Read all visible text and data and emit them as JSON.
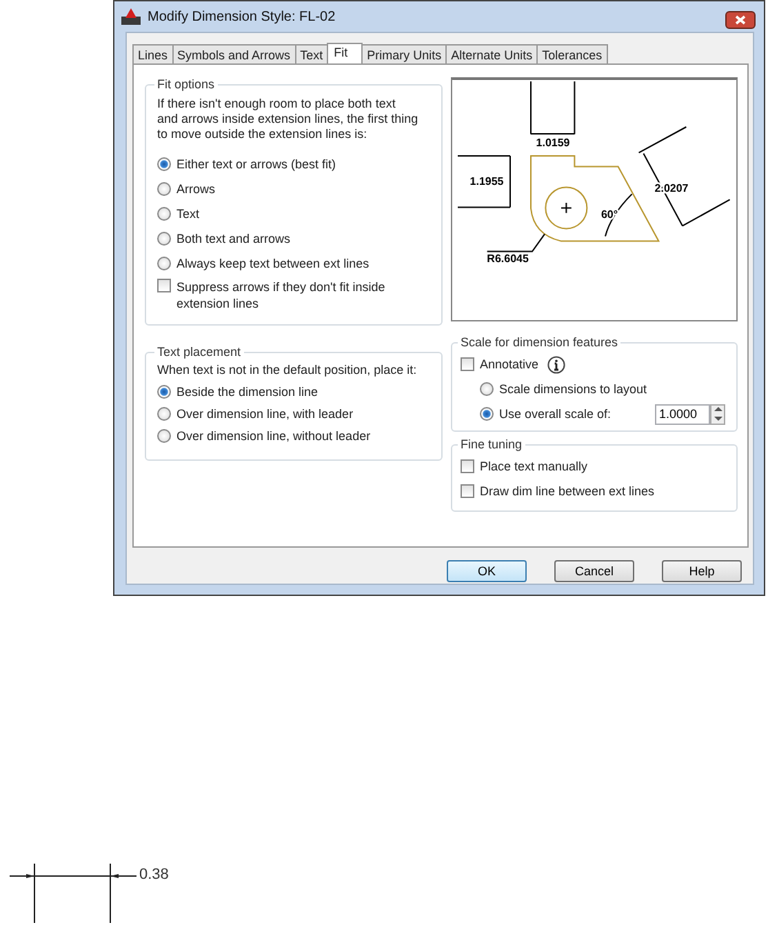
{
  "window": {
    "title": "Modify Dimension Style: FL-02"
  },
  "tabs": [
    {
      "label": "Lines",
      "selected": false
    },
    {
      "label": "Symbols and Arrows",
      "selected": false
    },
    {
      "label": "Text",
      "selected": false
    },
    {
      "label": "Fit",
      "selected": true
    },
    {
      "label": "Primary Units",
      "selected": false
    },
    {
      "label": "Alternate Units",
      "selected": false
    },
    {
      "label": "Tolerances",
      "selected": false
    }
  ],
  "fit_options": {
    "title": "Fit options",
    "description": "If there isn't enough room to place both text and arrows inside extension lines, the first thing to move outside the extension lines is:",
    "options": [
      {
        "label": "Either text or arrows (best fit)",
        "selected": true
      },
      {
        "label": "Arrows",
        "selected": false
      },
      {
        "label": "Text",
        "selected": false
      },
      {
        "label": "Both text and arrows",
        "selected": false
      },
      {
        "label": "Always keep text between ext lines",
        "selected": false
      }
    ],
    "suppress_arrows": {
      "label": "Suppress arrows if they don't fit inside extension lines",
      "checked": false
    }
  },
  "preview": {
    "labels": [
      "1.0159",
      "1.1955",
      "2.0207",
      "60°",
      "R6.6045"
    ]
  },
  "text_placement": {
    "title": "Text placement",
    "description": "When text is not in the default position, place it:",
    "options": [
      {
        "label": "Beside the dimension line",
        "selected": true
      },
      {
        "label": "Over dimension line, with leader",
        "selected": false
      },
      {
        "label": "Over dimension line, without leader",
        "selected": false
      }
    ]
  },
  "scale": {
    "title": "Scale for dimension features",
    "annotative": {
      "label": "Annotative",
      "checked": false
    },
    "options": [
      {
        "label": "Scale dimensions to layout",
        "selected": false
      },
      {
        "label": "Use overall scale of:",
        "selected": true
      }
    ],
    "value": "1.0000"
  },
  "fine_tuning": {
    "title": "Fine tuning",
    "options": [
      {
        "label": "Place text manually",
        "checked": false
      },
      {
        "label": "Draw dim line between ext lines",
        "checked": false
      }
    ]
  },
  "buttons": [
    {
      "label": "OK",
      "default": true
    },
    {
      "label": "Cancel",
      "default": false
    },
    {
      "label": "Help",
      "default": false
    }
  ],
  "sketch": {
    "label": "0.38"
  }
}
